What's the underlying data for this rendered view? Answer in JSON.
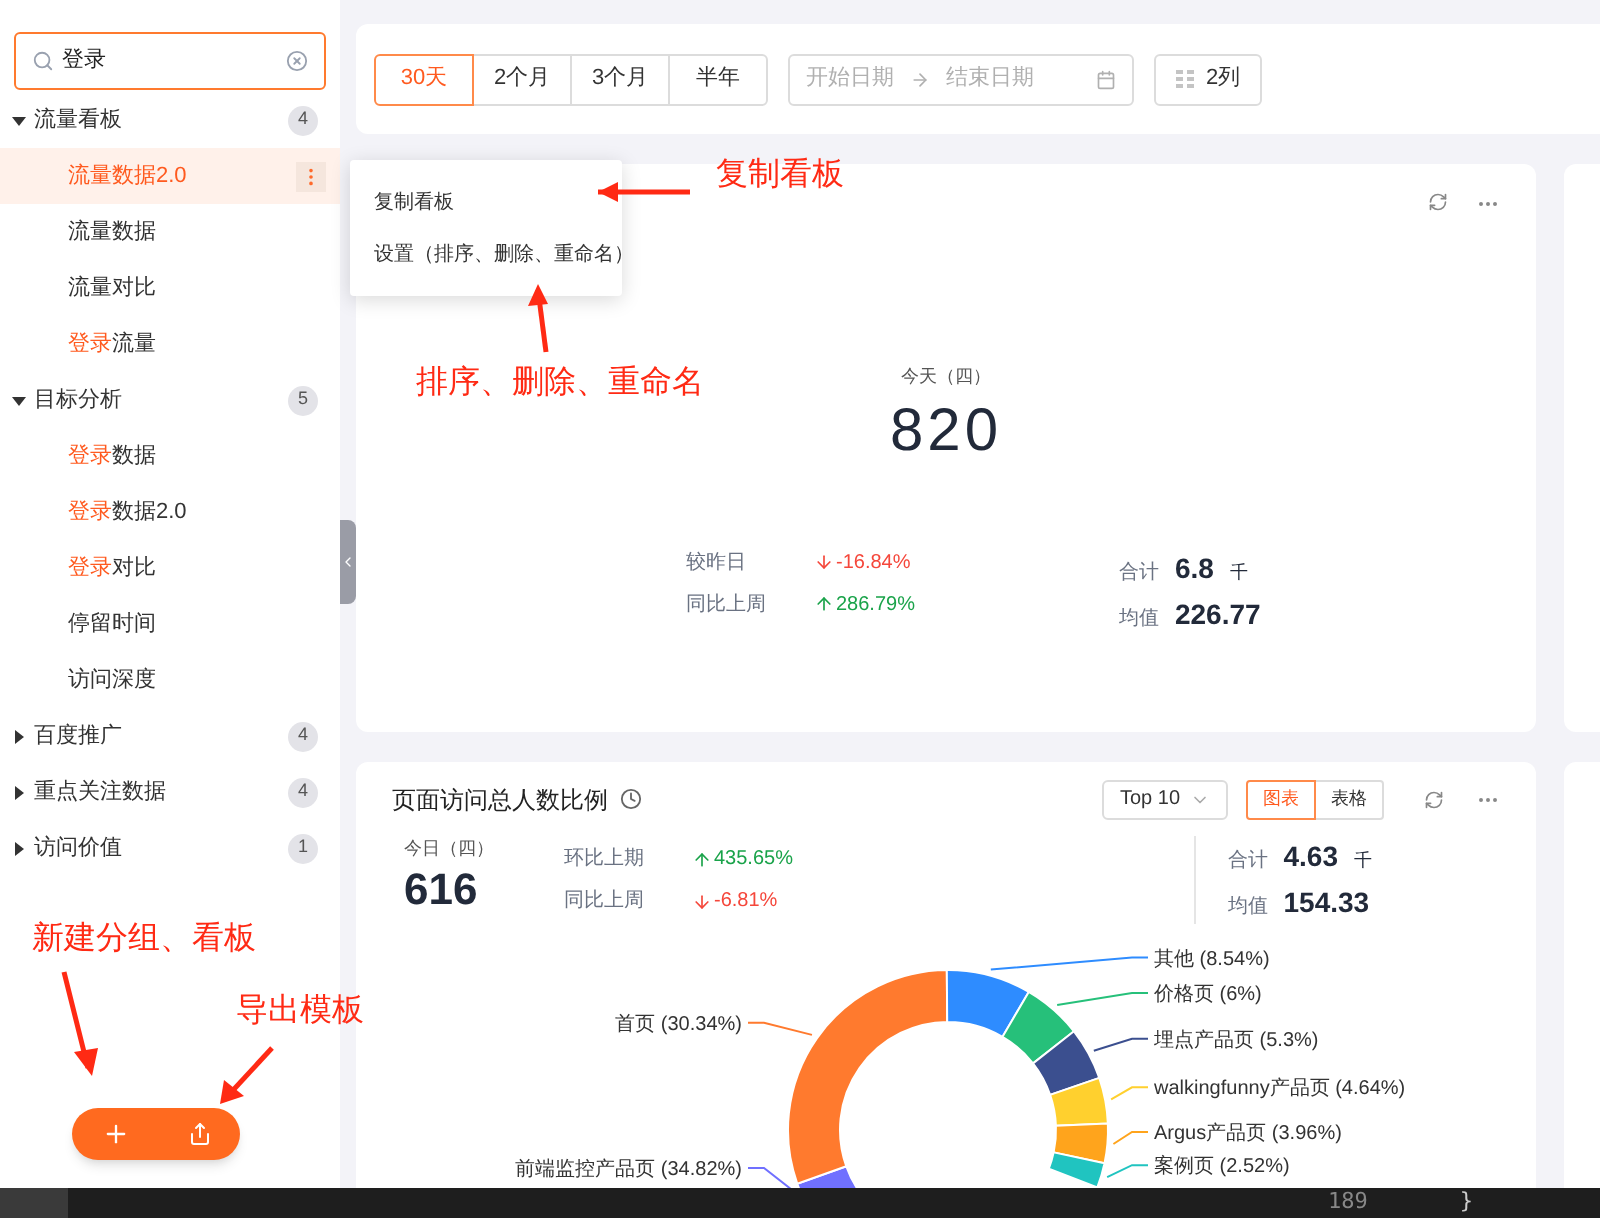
{
  "sidebar": {
    "search": {
      "value": "登录"
    },
    "groups": [
      {
        "name": "流量看板",
        "count": "4",
        "expanded": true,
        "children": [
          {
            "parts": [
              {
                "text": "流量数据2.0",
                "match": false
              }
            ],
            "selected": true
          },
          {
            "parts": [
              {
                "text": "流量数据",
                "match": false
              }
            ],
            "selected": false
          },
          {
            "parts": [
              {
                "text": "流量对比",
                "match": false
              }
            ],
            "selected": false
          },
          {
            "parts": [
              {
                "text": "登录",
                "match": true
              },
              {
                "text": "流量",
                "match": false
              }
            ],
            "selected": false
          }
        ]
      },
      {
        "name": "目标分析",
        "count": "5",
        "expanded": true,
        "children": [
          {
            "parts": [
              {
                "text": "登录",
                "match": true
              },
              {
                "text": "数据",
                "match": false
              }
            ],
            "selected": false
          },
          {
            "parts": [
              {
                "text": "登录",
                "match": true
              },
              {
                "text": "数据2.0",
                "match": false
              }
            ],
            "selected": false
          },
          {
            "parts": [
              {
                "text": "登录",
                "match": true
              },
              {
                "text": "对比",
                "match": false
              }
            ],
            "selected": false
          },
          {
            "parts": [
              {
                "text": "停留时间",
                "match": false
              }
            ],
            "selected": false
          },
          {
            "parts": [
              {
                "text": "访问深度",
                "match": false
              }
            ],
            "selected": false
          }
        ]
      },
      {
        "name": "百度推广",
        "count": "4",
        "expanded": false
      },
      {
        "name": "重点关注数据",
        "count": "4",
        "expanded": false
      },
      {
        "name": "访问价值",
        "count": "1",
        "expanded": false
      }
    ]
  },
  "toolbar": {
    "ranges": [
      {
        "label": "30天",
        "selected": true
      },
      {
        "label": "2个月",
        "selected": false
      },
      {
        "label": "3个月",
        "selected": false
      },
      {
        "label": "半年",
        "selected": false
      }
    ],
    "date_range": {
      "start_placeholder": "开始日期",
      "end_placeholder": "结束日期"
    },
    "columns_button": "2列"
  },
  "popup_menu": {
    "items": [
      "复制看板",
      "设置（排序、删除、重命名）"
    ]
  },
  "annotations": [
    {
      "kind": "copy",
      "text": "复制看板"
    },
    {
      "kind": "settings",
      "text": "排序、删除、重命名"
    },
    {
      "kind": "new",
      "text": "新建分组、看板"
    },
    {
      "kind": "export",
      "text": "导出模板"
    }
  ],
  "card1": {
    "today_label": "今天（四）",
    "value": "820",
    "comparisons": [
      {
        "label": "较昨日",
        "value": "-16.84%",
        "up": false
      },
      {
        "label": "同比上周",
        "value": "286.79%",
        "up": true
      }
    ],
    "total_label": "合计",
    "total": "6.8",
    "total_unit": "千",
    "avg_label": "均值",
    "avg": "226.77"
  },
  "card2": {
    "title": "页面访问总人数比例",
    "top_select": "Top 10",
    "view_tabs": [
      {
        "label": "图表",
        "selected": true
      },
      {
        "label": "表格",
        "selected": false
      }
    ],
    "today_label": "今日（四）",
    "value": "616",
    "comparisons": [
      {
        "label": "环比上期",
        "value": "435.65%",
        "up": true
      },
      {
        "label": "同比上周",
        "value": "-6.81%",
        "up": false
      }
    ],
    "total_label": "合计",
    "total": "4.63",
    "total_unit": "千",
    "avg_label": "均值",
    "avg": "154.33",
    "chart_data": {
      "type": "donut",
      "value_labels": [
        "(34.82%)",
        "(30.34%)",
        "(8.54%)",
        "(6%)",
        "(5.3%)",
        "(4.64%)",
        "(3.96%)",
        "(2.52%)"
      ],
      "categories": [
        "前端监控产品页",
        "首页",
        "其他",
        "价格页",
        "埋点产品页",
        "walkingfunny产品页",
        "Argus产品页",
        "案例页"
      ],
      "values": [
        34.82,
        30.34,
        8.54,
        6,
        5.3,
        4.64,
        3.96,
        2.52
      ],
      "colors": [
        "#7070ff",
        "#ff7a2e",
        "#2e8cff",
        "#26c07a",
        "#3b4f8f",
        "#ffd02e",
        "#ffa41c",
        "#20c4c0"
      ]
    }
  },
  "editor_strip": {
    "line_number": "189",
    "brace": "}"
  }
}
